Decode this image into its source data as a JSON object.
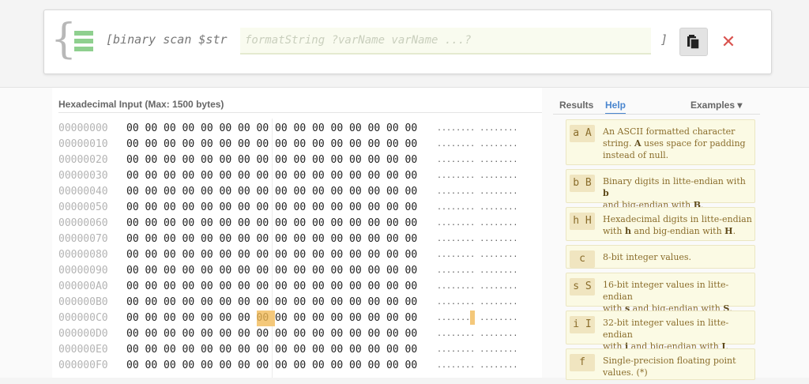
{
  "command": {
    "prefix": "[binary scan $str",
    "format_placeholder": "formatString ?varName varName ...?",
    "suffix": "]",
    "copy_icon": "clipboard-icon",
    "close_icon": "close-icon",
    "close_glyph": "✕"
  },
  "hex": {
    "title": "Hexadecimal Input (Max: 1500 bytes)",
    "rows": [
      {
        "offset": "00000000",
        "ascii_left": "........",
        "ascii_right": "........"
      },
      {
        "offset": "00000010",
        "ascii_left": "........",
        "ascii_right": "........"
      },
      {
        "offset": "00000020",
        "ascii_left": "........",
        "ascii_right": "........"
      },
      {
        "offset": "00000030",
        "ascii_left": "........",
        "ascii_right": "........"
      },
      {
        "offset": "00000040",
        "ascii_left": "........",
        "ascii_right": "........"
      },
      {
        "offset": "00000050",
        "ascii_left": "........",
        "ascii_right": "........"
      },
      {
        "offset": "00000060",
        "ascii_left": "........",
        "ascii_right": "........"
      },
      {
        "offset": "00000070",
        "ascii_left": "........",
        "ascii_right": "........"
      },
      {
        "offset": "00000080",
        "ascii_left": "........",
        "ascii_right": "........"
      },
      {
        "offset": "00000090",
        "ascii_left": "........",
        "ascii_right": "........"
      },
      {
        "offset": "000000A0",
        "ascii_left": "........",
        "ascii_right": "........"
      },
      {
        "offset": "000000B0",
        "ascii_left": "........",
        "ascii_right": "........"
      },
      {
        "offset": "000000C0",
        "ascii_left": ".......",
        "ascii_right": "........",
        "highlight_byte": 7
      },
      {
        "offset": "000000D0",
        "ascii_left": "........",
        "ascii_right": "........"
      },
      {
        "offset": "000000E0",
        "ascii_left": "........",
        "ascii_right": "........"
      },
      {
        "offset": "000000F0",
        "ascii_left": "........",
        "ascii_right": "........"
      }
    ],
    "byte_value": "00",
    "bytes_per_row": 16
  },
  "tabs": {
    "results": "Results",
    "help": "Help",
    "examples": "Examples ▾"
  },
  "help_items": [
    {
      "code": "a A",
      "lines": [
        "An ASCII formatted character",
        "string. <b>A</b> uses space for padding",
        "instead of null."
      ]
    },
    {
      "code": "b B",
      "lines": [
        "Binary digits in litte-endian with <b>b</b>",
        "and big-endian with <b>B</b>."
      ]
    },
    {
      "code": "h H",
      "lines": [
        "Hexadecimal digits in litte-endian",
        "with <b>h</b> and big-endian with <b>H</b>."
      ]
    },
    {
      "code": "c",
      "lines": [
        "8-bit integer values."
      ]
    },
    {
      "code": "s S",
      "lines": [
        "16-bit integer values in litte-endian",
        "with <b>s</b> and big-endian with <b>S</b>."
      ]
    },
    {
      "code": "i I",
      "lines": [
        "32-bit integer values in litte-endian",
        "with <b>i</b> and big-endian with <b>I</b>."
      ]
    },
    {
      "code": "f",
      "lines": [
        "Single-precision floating point",
        "values. (*)"
      ]
    }
  ]
}
